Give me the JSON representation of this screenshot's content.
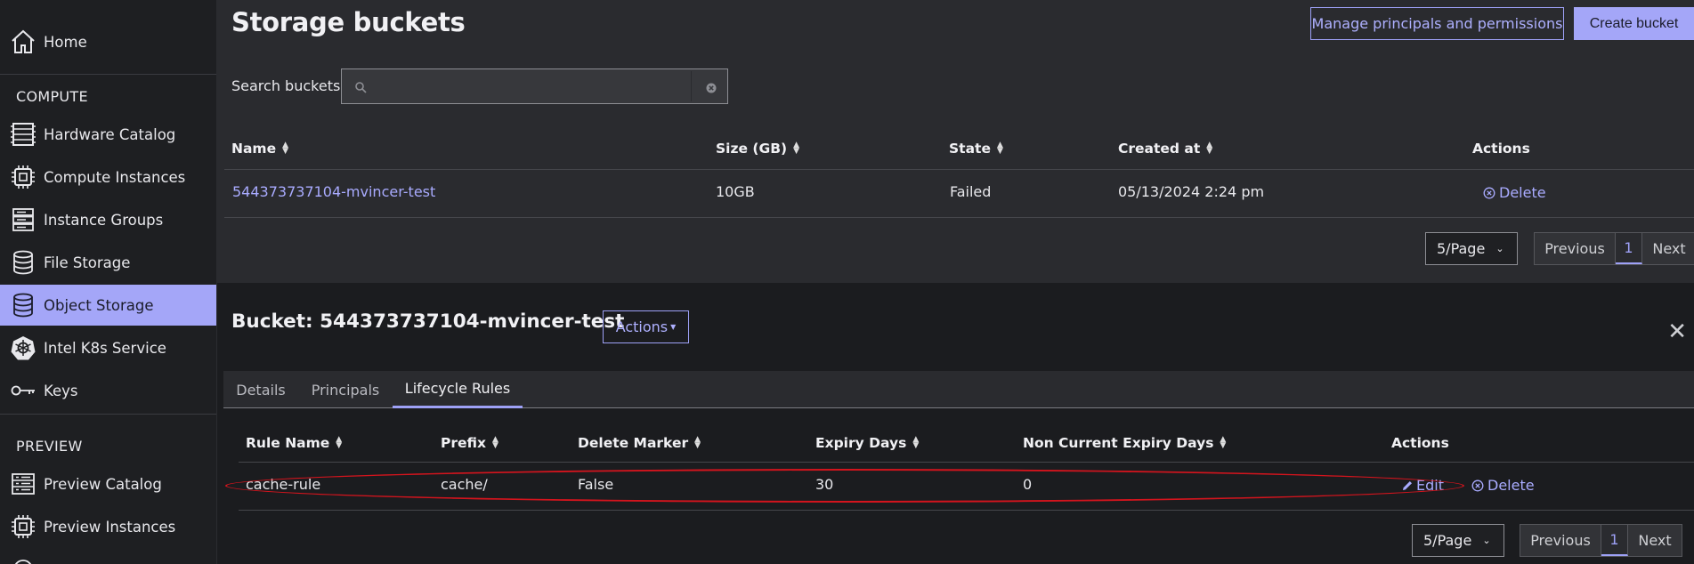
{
  "sidebar": {
    "home_label": "Home",
    "compute_section": "COMPUTE",
    "compute_items": [
      {
        "label": "Hardware Catalog",
        "icon": "server-rack-icon"
      },
      {
        "label": "Compute Instances",
        "icon": "chip-icon"
      },
      {
        "label": "Instance Groups",
        "icon": "server-stack-icon"
      },
      {
        "label": "File Storage",
        "icon": "database-icon"
      },
      {
        "label": "Object Storage",
        "icon": "database-icon",
        "active": true
      },
      {
        "label": "Intel K8s Service",
        "icon": "kubernetes-icon"
      },
      {
        "label": "Keys",
        "icon": "key-icon"
      }
    ],
    "preview_section": "PREVIEW",
    "preview_items": [
      {
        "label": "Preview Catalog",
        "icon": "list-icon"
      },
      {
        "label": "Preview Instances",
        "icon": "chip-icon"
      }
    ]
  },
  "header": {
    "title": "Storage buckets",
    "manage_button": "Manage principals and permissions",
    "create_button": "Create bucket"
  },
  "search": {
    "label": "Search buckets",
    "value": "",
    "placeholder": ""
  },
  "buckets_table": {
    "columns": [
      "Name",
      "Size (GB)",
      "State",
      "Created at",
      "Actions"
    ],
    "rows": [
      {
        "name": "544373737104-mvincer-test",
        "size": "10GB",
        "state": "Failed",
        "created": "05/13/2024 2:24 pm",
        "action": "Delete"
      }
    ],
    "pagination": {
      "page_size": "5/Page",
      "previous": "Previous",
      "current": "1",
      "next": "Next"
    }
  },
  "bucket_detail": {
    "title": "Bucket: 544373737104-mvincer-test",
    "actions_button": "Actions",
    "tabs": [
      "Details",
      "Principals",
      "Lifecycle Rules"
    ],
    "active_tab": "Lifecycle Rules"
  },
  "rules_table": {
    "columns": [
      "Rule Name",
      "Prefix",
      "Delete Marker",
      "Expiry Days",
      "Non Current Expiry Days",
      "Actions"
    ],
    "rows": [
      {
        "rule_name": "cache-rule",
        "prefix": "cache/",
        "delete_marker": "False",
        "expiry_days": "30",
        "noncurrent_expiry_days": "0",
        "edit": "Edit",
        "delete": "Delete"
      }
    ],
    "pagination": {
      "page_size": "5/Page",
      "previous": "Previous",
      "current": "1",
      "next": "Next"
    }
  },
  "colors": {
    "accent": "#a4a6f8",
    "link": "#a9abff",
    "highlight": "#d4141d"
  }
}
